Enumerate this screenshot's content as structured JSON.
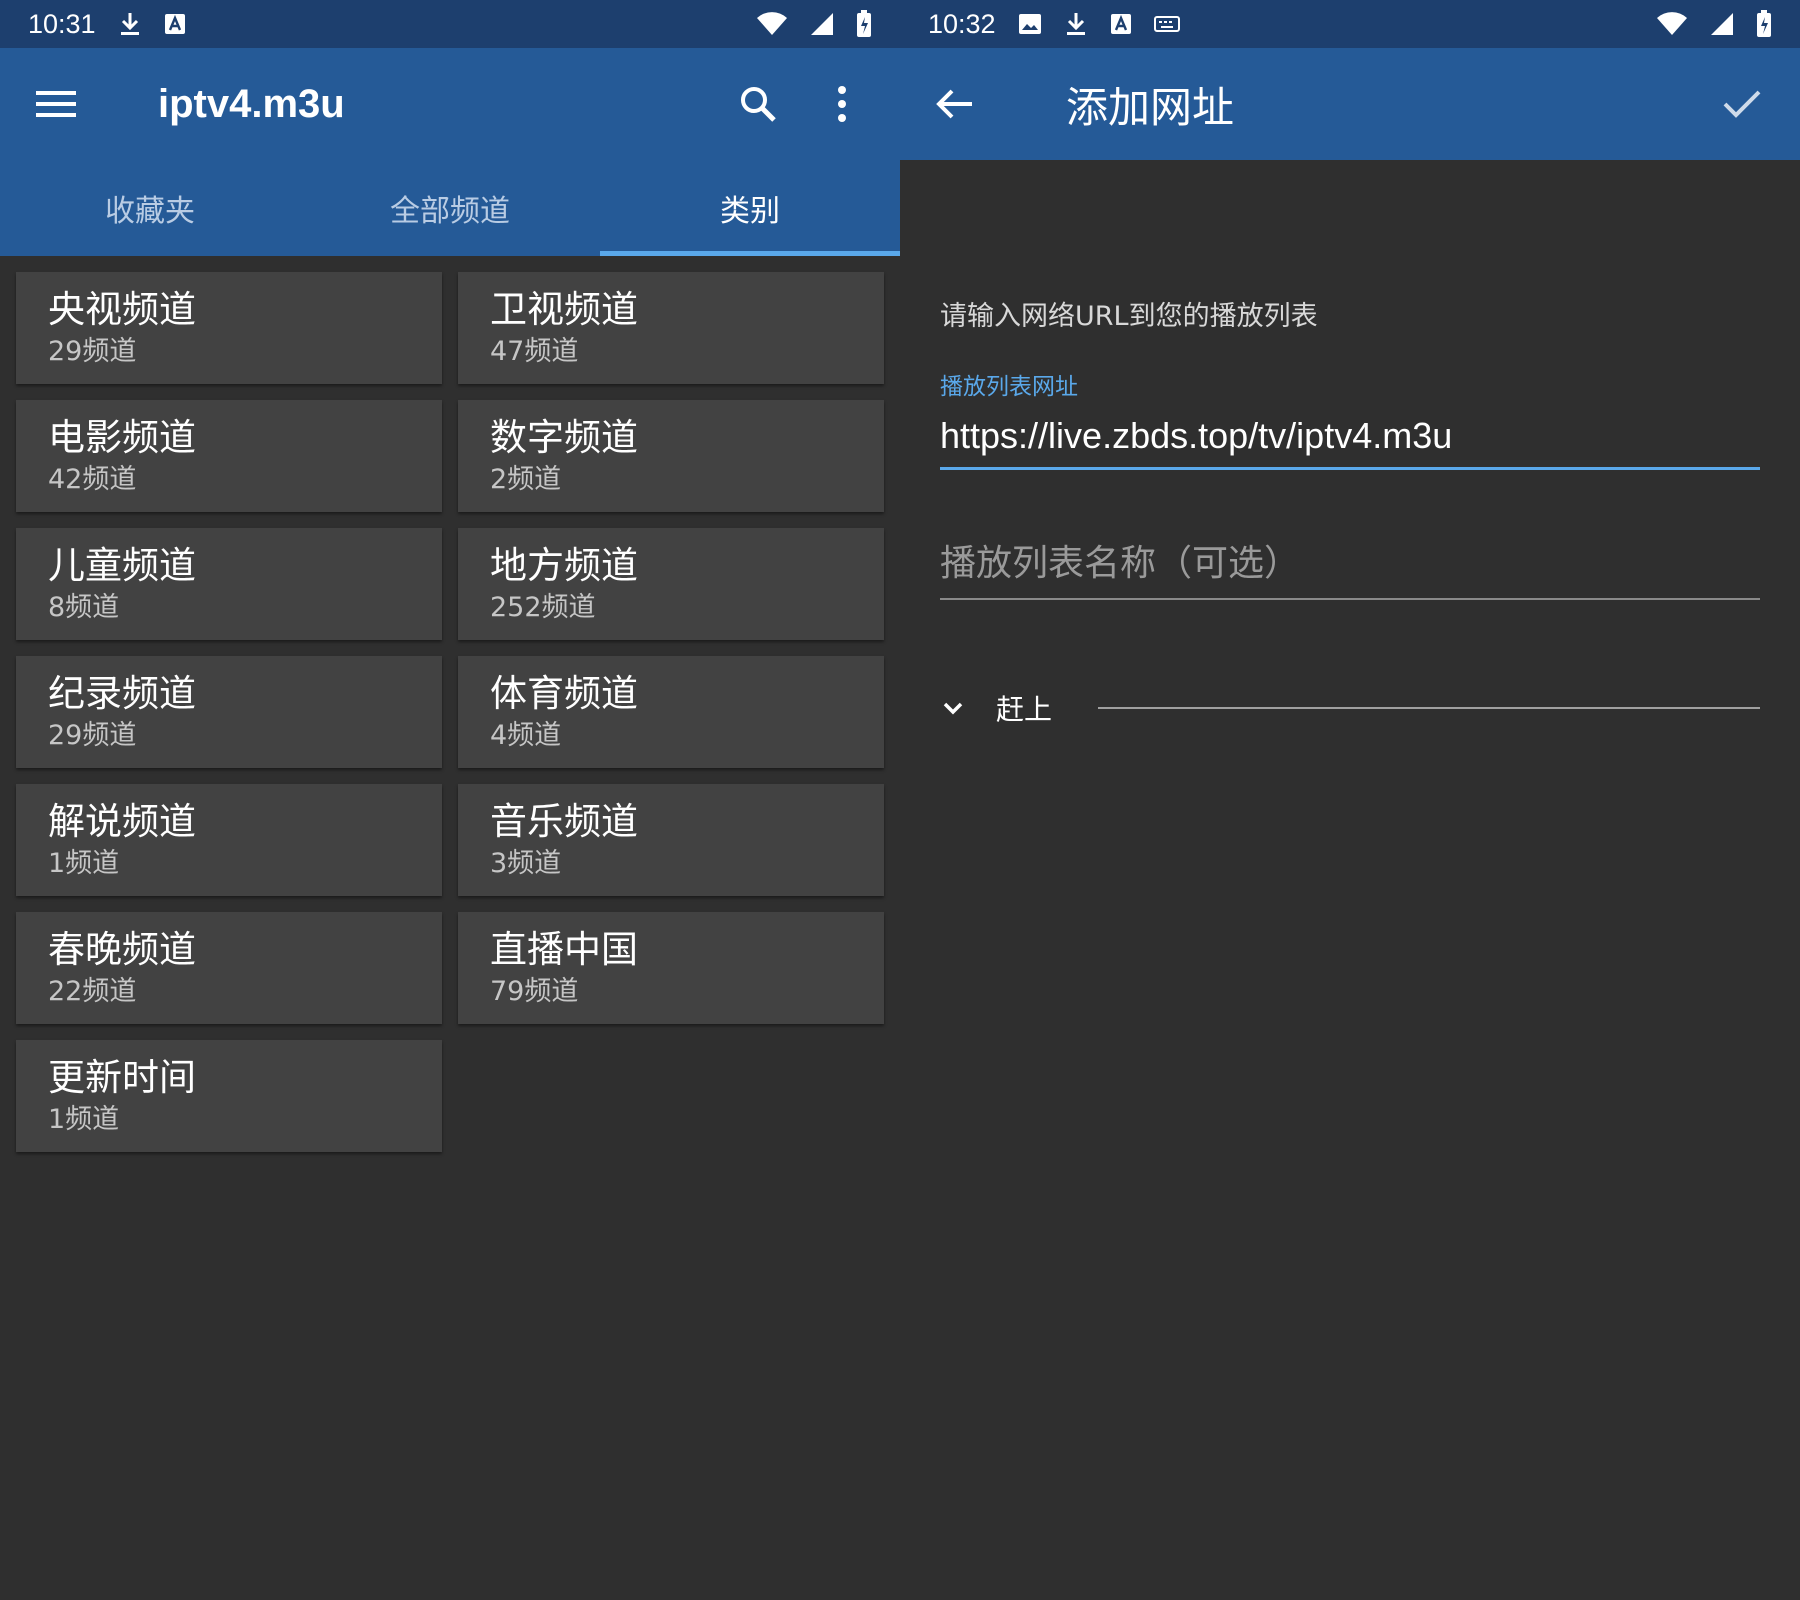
{
  "colors": {
    "status_bar": "#1d3f6e",
    "app_bar": "#255a97",
    "accent": "#5aa8ea",
    "background": "#2f2f2f",
    "card": "#424242"
  },
  "left": {
    "status": {
      "time": "10:31",
      "icons": [
        "download-icon",
        "a-notification-icon",
        "wifi-icon",
        "signal-icon",
        "battery-icon"
      ]
    },
    "appbar": {
      "menu_icon": "hamburger-menu-icon",
      "title": "iptv4.m3u",
      "actions": [
        "search-icon",
        "more-vert-icon"
      ]
    },
    "tabs": [
      {
        "label": "收藏夹",
        "active": false
      },
      {
        "label": "全部频道",
        "active": false
      },
      {
        "label": "类别",
        "active": true
      }
    ],
    "categories": [
      {
        "name": "央视频道",
        "count": "29频道"
      },
      {
        "name": "卫视频道",
        "count": "47频道"
      },
      {
        "name": "电影频道",
        "count": "42频道"
      },
      {
        "name": "数字频道",
        "count": "2频道"
      },
      {
        "name": "儿童频道",
        "count": "8频道"
      },
      {
        "name": "地方频道",
        "count": "252频道"
      },
      {
        "name": "纪录频道",
        "count": "29频道"
      },
      {
        "name": "体育频道",
        "count": "4频道"
      },
      {
        "name": "解说频道",
        "count": "1频道"
      },
      {
        "name": "音乐频道",
        "count": "3频道"
      },
      {
        "name": "春晚频道",
        "count": "22频道"
      },
      {
        "name": "直播中国",
        "count": "79频道"
      },
      {
        "name": "更新时间",
        "count": "1频道"
      }
    ]
  },
  "right": {
    "status": {
      "time": "10:32",
      "icons": [
        "image-icon",
        "download-icon",
        "a-notification-icon",
        "keyboard-icon",
        "wifi-icon",
        "signal-icon",
        "battery-icon"
      ]
    },
    "appbar": {
      "back_icon": "back-arrow-icon",
      "title": "添加网址",
      "confirm_icon": "check-icon"
    },
    "form": {
      "prompt": "请输入网络URL到您的播放列表",
      "url_label": "播放列表网址",
      "url_value": "https://live.zbds.top/tv/iptv4.m3u",
      "name_placeholder": "播放列表名称（可选）",
      "expander_label": "赶上"
    }
  }
}
